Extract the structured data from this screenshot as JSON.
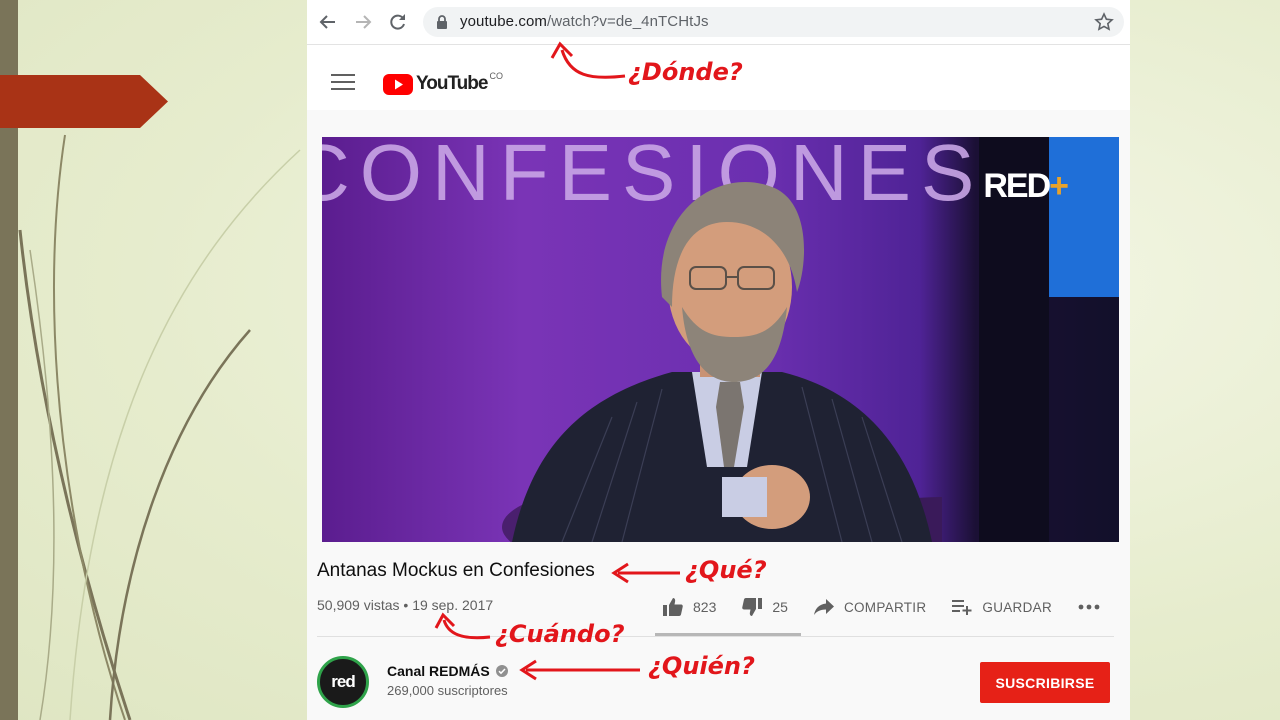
{
  "browser": {
    "url_domain": "youtube.com",
    "url_path": "/watch?v=de_4nTCHtJs"
  },
  "youtube": {
    "logo_text": "YouTube",
    "country": "CO"
  },
  "video": {
    "overlay_text": "CONFESIONES",
    "channel_logo": "RED",
    "title": "Antanas Mockus en Confesiones",
    "views": "50,909 vistas",
    "separator": "•",
    "date": "19 sep. 2017",
    "likes": "823",
    "dislikes": "25",
    "share_label": "COMPARTIR",
    "save_label": "GUARDAR"
  },
  "channel": {
    "avatar_text": "red",
    "name": "Canal REDMÁS",
    "subscribers": "269,000 suscriptores",
    "subscribe_label": "SUSCRIBIRSE"
  },
  "annotations": {
    "where": "¿Dónde?",
    "what": "¿Qué?",
    "when": "¿Cuándo?",
    "who": "¿Quién?"
  },
  "colors": {
    "annotation_red": "#e2161b",
    "subscribe_red": "#e62117",
    "slide_arrow": "#a93316"
  },
  "icons": [
    "back-icon",
    "forward-icon",
    "reload-icon",
    "lock-icon",
    "star-icon",
    "hamburger-icon",
    "youtube-play-icon",
    "like-icon",
    "dislike-icon",
    "share-icon",
    "playlist-add-icon",
    "more-icon",
    "verified-icon"
  ]
}
